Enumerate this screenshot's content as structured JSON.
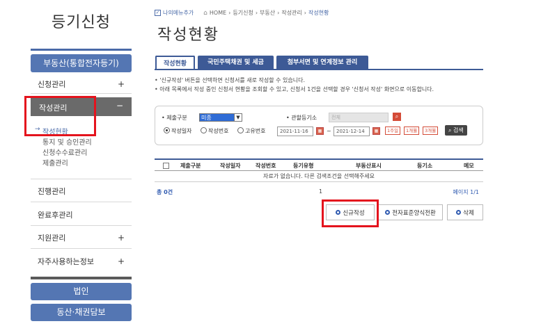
{
  "sidebar": {
    "title": "등기신청",
    "main_button": "부동산(통합전자등기)",
    "menu": [
      {
        "label": "신청관리",
        "toggle": "+"
      },
      {
        "label": "작성관리",
        "toggle": "−"
      },
      {
        "label": "진행관리",
        "toggle": ""
      },
      {
        "label": "완료후관리",
        "toggle": ""
      },
      {
        "label": "지원관리",
        "toggle": "+"
      },
      {
        "label": "자주사용하는정보",
        "toggle": "+"
      }
    ],
    "submenu": [
      {
        "label": "작성현황",
        "arrow": "→"
      },
      {
        "label": "통지 및 승인관리"
      },
      {
        "label": "신청수수료관리"
      },
      {
        "label": "제출관리"
      }
    ],
    "bottom_buttons": [
      "법인",
      "동산·채권담보"
    ]
  },
  "header": {
    "favorite": "나의메뉴추가",
    "breadcrumb": [
      "HOME",
      "등기신청",
      "부동산",
      "작성관리",
      "작성현황"
    ],
    "page_title": "작성현황"
  },
  "tabs": [
    "작성현황",
    "국민주택채권 및 세금",
    "첨부서면 및 연계정보 관리"
  ],
  "notes": [
    "• '신규작성' 버튼을 선택하면 신청서를 새로 작성할 수 있습니다.",
    "• 아래 목록에서 작성 중인 신청서 현황을 조회할 수 있고, 신청서 1건을 선택할 경우 '신청서 작성' 화면으로 이동합니다."
  ],
  "search": {
    "submit_type_label": "• 제출구분",
    "submit_type_value": "미종",
    "registry_label": "• 관할등기소",
    "registry_placeholder": "전체",
    "radio_options": [
      "작성일자",
      "작성번호",
      "고유번호"
    ],
    "selected_radio": "작성일자",
    "date_from": "2021-11-16",
    "date_to": "2021-12-14",
    "tilde": "~",
    "period_buttons": [
      "1주일",
      "1개월",
      "3개월"
    ],
    "search_button": "검색"
  },
  "table": {
    "columns": [
      "제출구분",
      "작성일자",
      "작성번호",
      "등기유형",
      "부동산표시",
      "등기소",
      "메모"
    ],
    "empty_message": "자료가 없습니다. 다른 검색조건을 선택해주세요",
    "total_label": "총 0건",
    "pager_current": "1",
    "page_info": "페이지 1/1"
  },
  "actions": [
    "신규작성",
    "전자표준양식전환",
    "삭제"
  ],
  "colors": {
    "primary": "#3d5a96",
    "sidebar_blue": "#5476b3",
    "highlight_red": "#e4131d"
  }
}
